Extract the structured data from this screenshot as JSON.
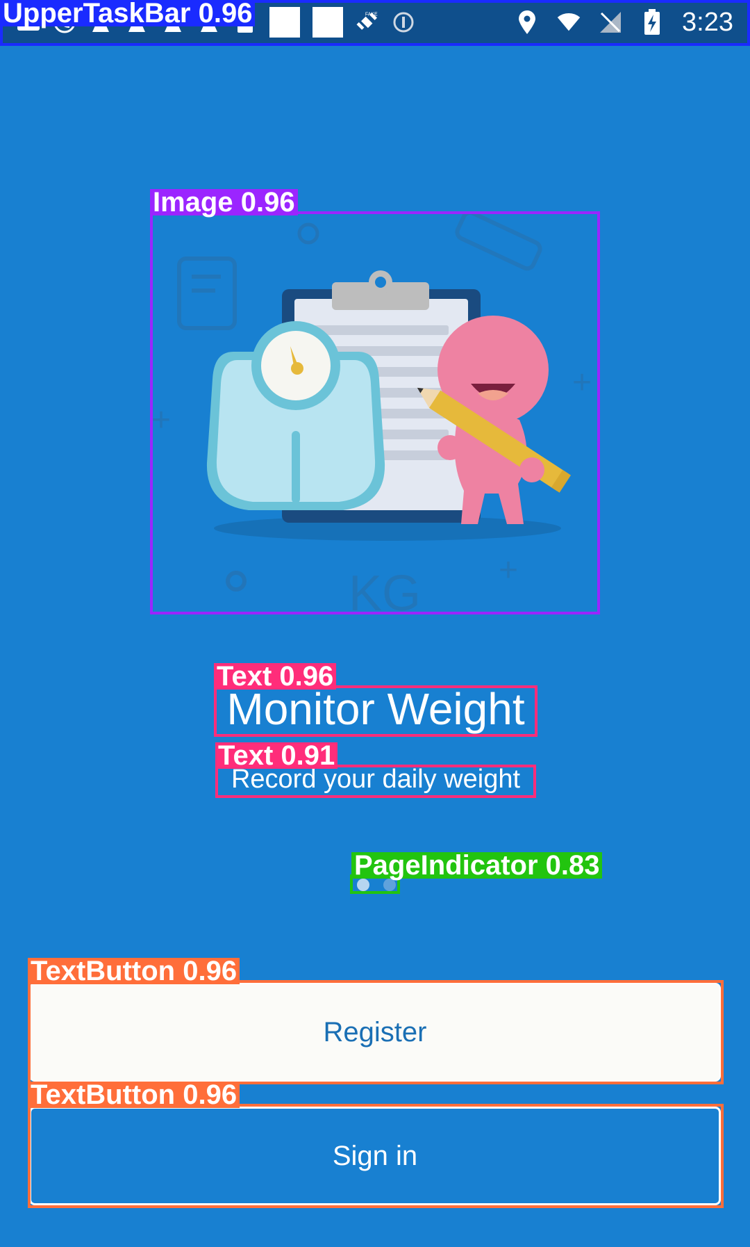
{
  "status_bar": {
    "time": "3:23",
    "left_icons": [
      "mail-icon",
      "phone-icon",
      "a-icon",
      "a-icon",
      "a-icon",
      "a-icon",
      "lock-icon",
      "square-icon",
      "square-icon",
      "satellite-fake-icon",
      "info-circle-icon"
    ],
    "right_icons": [
      "location-icon",
      "wifi-icon",
      "no-sim-icon",
      "battery-charging-icon"
    ],
    "fake_label": "FAKE"
  },
  "detections": {
    "status_bar": "UpperTaskBar 0.96",
    "image": "Image 0.96",
    "title": "Text 0.96",
    "subtitle": "Text 0.91",
    "indicator": "PageIndicator 0.83",
    "register": "TextButton 0.96",
    "signin": "TextButton 0.96"
  },
  "onboarding": {
    "illustration_text": "KG",
    "title": "Monitor Weight",
    "subtitle": "Record your daily weight",
    "page_indicator": {
      "pages": 2,
      "active": 0
    }
  },
  "buttons": {
    "register": "Register",
    "signin": "Sign in"
  },
  "colors": {
    "background": "#1880d1",
    "status_bar": "#0f4f8c",
    "register_text": "#1a6fb4",
    "dot_active": "#b7d6f0",
    "dot_inactive": "#5fa2dc",
    "box_status": "#1a2bff",
    "box_image": "#9b25ff",
    "box_text": "#ff2d7a",
    "box_indicator": "#22c40f",
    "box_button": "#ff6e3a"
  }
}
